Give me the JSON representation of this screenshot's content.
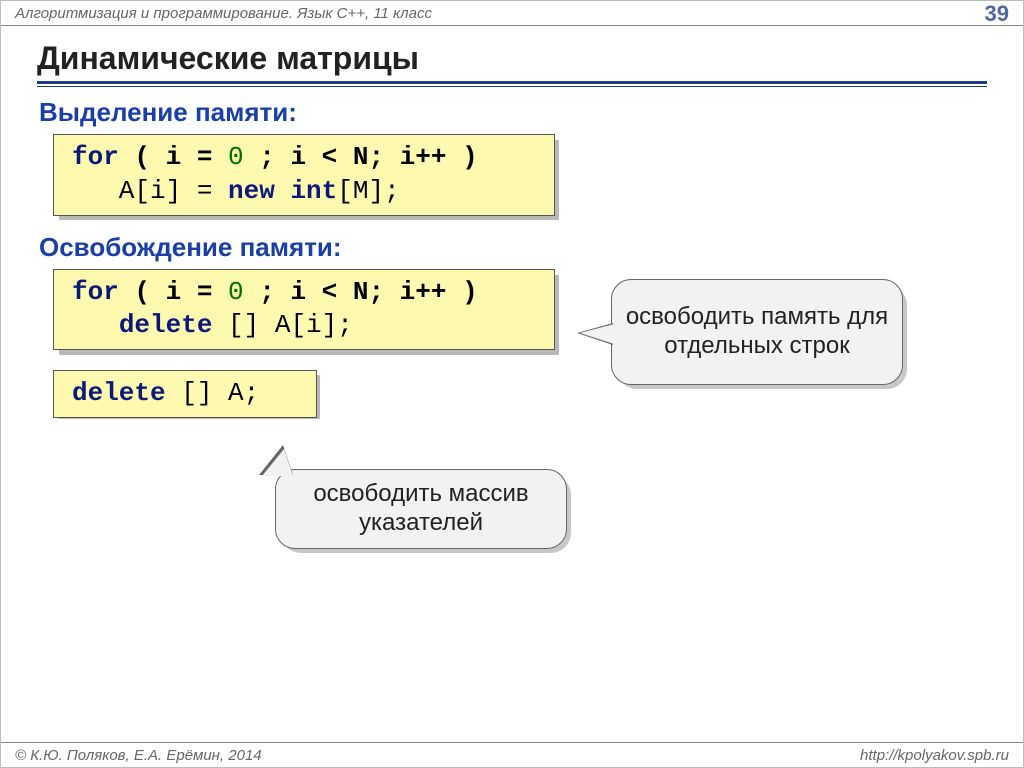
{
  "header": {
    "course": "Алгоритмизация и программирование. Язык C++, 11 класс",
    "pageNumber": "39"
  },
  "title": "Динамические матрицы",
  "sections": {
    "alloc": {
      "label": "Выделение памяти:",
      "code": {
        "part1": "for",
        "part2": " ( i = ",
        "zero": "0",
        "part3": " ; i < N; i++ )",
        "line2a": "   A[i] = ",
        "newkw": "new",
        "line2b": " int",
        "line2c": "[M];"
      }
    },
    "free": {
      "label": "Освобождение памяти:",
      "code1": {
        "part1": "for",
        "part2": " ( i = ",
        "zero": "0",
        "part3": " ; i < N; i++ )",
        "line2a": "   ",
        "delkw": "delete",
        "line2b": " [] A[i];"
      },
      "code2": {
        "delkw": "delete",
        "rest": " [] A;"
      }
    }
  },
  "callouts": {
    "rows": "освободить память для отдельных строк",
    "ptrArray": "освободить массив указателей"
  },
  "footer": {
    "left": "© К.Ю. Поляков, Е.А. Ерёмин, 2014",
    "right": "http://kpolyakov.spb.ru"
  }
}
